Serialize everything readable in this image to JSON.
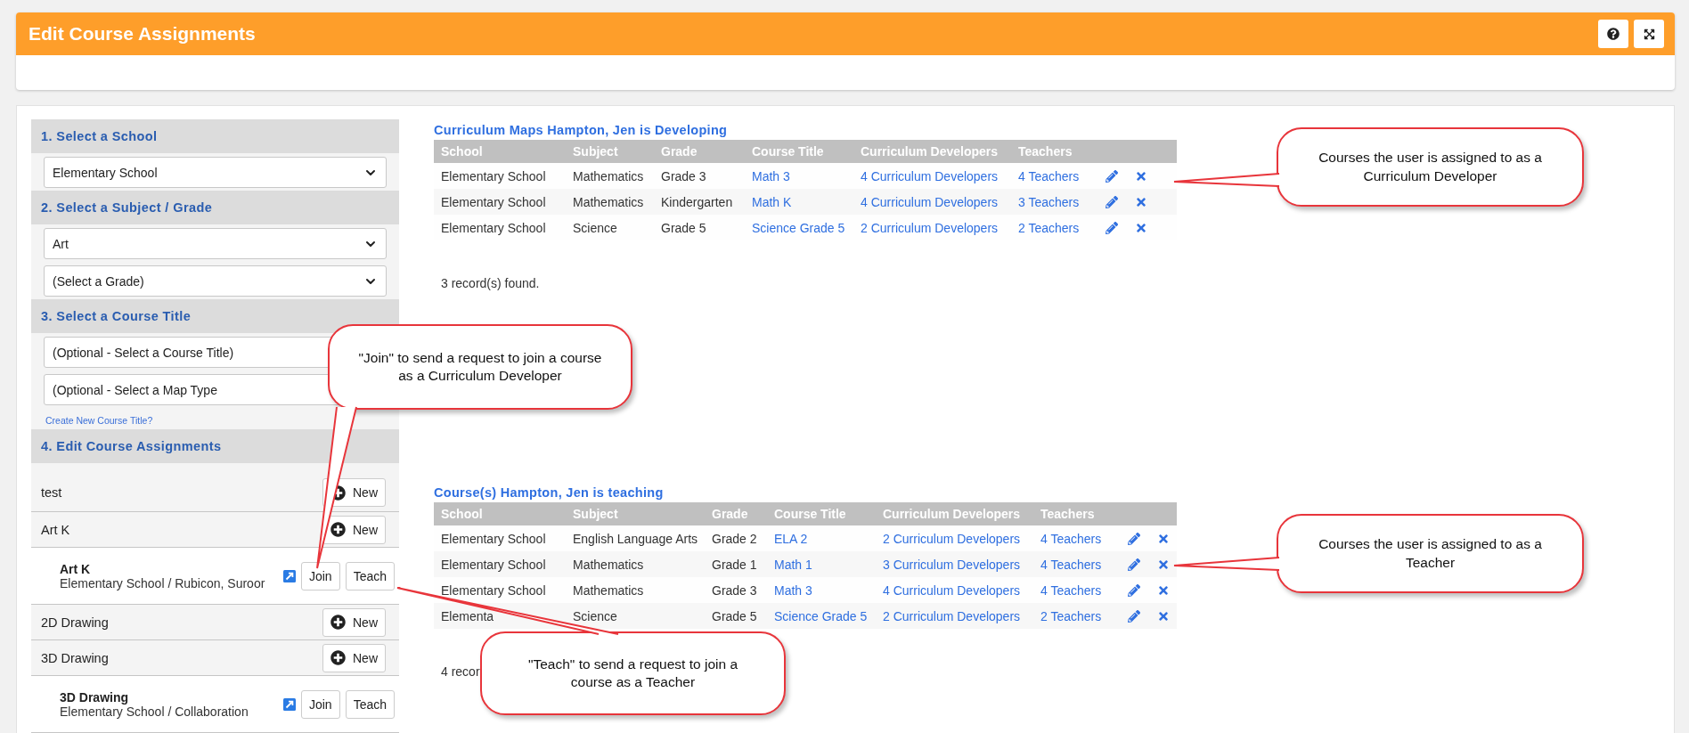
{
  "header": {
    "title": "Edit Course Assignments",
    "buttons": [
      {
        "kind": "help"
      },
      {
        "kind": "expand"
      }
    ]
  },
  "filters": [
    {
      "heading": "1. Select a School",
      "selects": [
        "Elementary School"
      ]
    },
    {
      "heading": "2. Select a Subject / Grade",
      "selects": [
        "Art",
        "(Select a Grade)"
      ]
    },
    {
      "heading": "3. Select a Course Title",
      "selects": [
        "(Optional - Select a Course Title)",
        "(Optional - Select a Map Type"
      ],
      "link": "Create New Course Title?"
    }
  ],
  "assignments": {
    "heading": "4. Edit Course Assignments",
    "items": [
      {
        "kind": "group",
        "title": "test",
        "button": "New"
      },
      {
        "kind": "group",
        "title": "Art K",
        "button": "New"
      },
      {
        "kind": "course",
        "title": "Art K",
        "detail": "Elementary School / Rubicon, Suroor",
        "buttons": [
          "Join",
          "Teach"
        ]
      },
      {
        "kind": "group",
        "title": "2D Drawing",
        "button": "New"
      },
      {
        "kind": "group",
        "title": "3D Drawing",
        "button": "New"
      },
      {
        "kind": "course",
        "title": "3D Drawing",
        "detail": "Elementary School / Collaboration",
        "buttons": [
          "Join",
          "Teach"
        ]
      }
    ]
  },
  "tables": [
    {
      "title": "Curriculum Maps Hampton, Jen is Developing",
      "columns": [
        "School",
        "Subject",
        "Grade",
        "Course Title",
        "Curriculum Developers",
        "Teachers"
      ],
      "rows": [
        [
          "Elementary School",
          "Mathematics",
          "Grade 3",
          "Math 3",
          "4 Curriculum Developers",
          "4 Teachers"
        ],
        [
          "Elementary School",
          "Mathematics",
          "Kindergarten",
          "Math K",
          "4 Curriculum Developers",
          "3 Teachers"
        ],
        [
          "Elementary School",
          "Science",
          "Grade 5",
          "Science Grade 5",
          "2 Curriculum Developers",
          "2 Teachers"
        ]
      ],
      "footer": "3 record(s) found."
    },
    {
      "title": "Course(s) Hampton, Jen is teaching",
      "columns": [
        "School",
        "Subject",
        "Grade",
        "Course Title",
        "Curriculum Developers",
        "Teachers"
      ],
      "rows": [
        [
          "Elementary School",
          "English Language Arts",
          "Grade 2",
          "ELA 2",
          "2 Curriculum Developers",
          "4 Teachers"
        ],
        [
          "Elementary School",
          "Mathematics",
          "Grade 1",
          "Math 1",
          "3 Curriculum Developers",
          "4 Teachers"
        ],
        [
          "Elementary School",
          "Mathematics",
          "Grade 3",
          "Math 3",
          "4 Curriculum Developers",
          "4 Teachers"
        ],
        [
          "Elementa",
          "Science",
          "Grade 5",
          "Science Grade 5",
          "2 Curriculum Developers",
          "2 Teachers"
        ]
      ],
      "footer": "4 recor"
    }
  ],
  "callouts": [
    {
      "text": "Courses the user is assigned to as a Curriculum Developer"
    },
    {
      "text": "\"Join\" to send a request to join a course as a Curriculum Developer"
    },
    {
      "text": "Courses the user is assigned to as a Teacher"
    },
    {
      "text": "\"Teach\" to send a request to join a course as a Teacher"
    }
  ]
}
